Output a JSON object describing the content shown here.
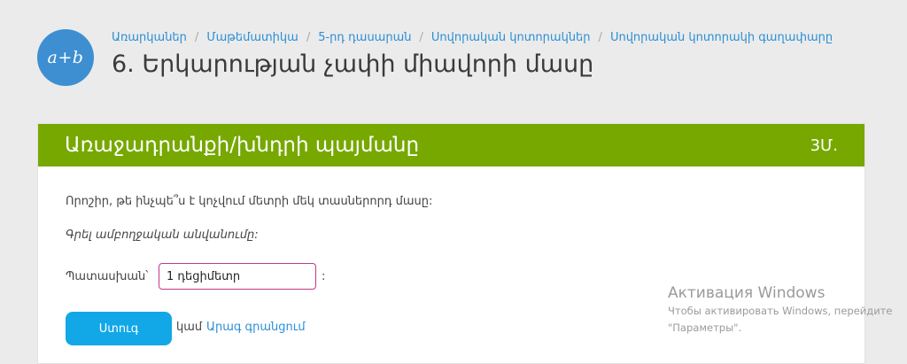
{
  "logo": {
    "text": "a+b"
  },
  "breadcrumb": [
    "Առարկաներ",
    "Մաթեմատիկա",
    "5-րդ դասարան",
    "Սովորական կոտորակներ",
    "Սովորական կոտորակի գաղափարը"
  ],
  "breadcrumb_separator": "/",
  "page_title": "6. Երկարության չափի միավորի մասը",
  "task": {
    "header_title": "Առաջադրանքի/խնդրի պայմանը",
    "points": "3Մ.",
    "question": "Որոշիր, թե ինչպե՞ս է կոչվում մետրի մեկ տասներորդ մասը:",
    "instruction": "Գրել ամբողջական անվանումը:",
    "answer_label": "Պատասխան՝",
    "answer_value": "1 դեցիմետր",
    "answer_suffix": ":",
    "submit_label": "Ստուգ",
    "or_text": "կամ",
    "skip_label": "Արագ գրանցում"
  },
  "windows_watermark": {
    "title": "Активация Windows",
    "line1": "Чтобы активировать Windows, перейдите",
    "line2": "\"Параметры\"."
  },
  "colors": {
    "header_green": "#76a800",
    "link_blue": "#2a8fd6",
    "button_blue": "#12a8e8",
    "logo_blue": "#3d8fd1",
    "input_border": "#c0398a"
  }
}
